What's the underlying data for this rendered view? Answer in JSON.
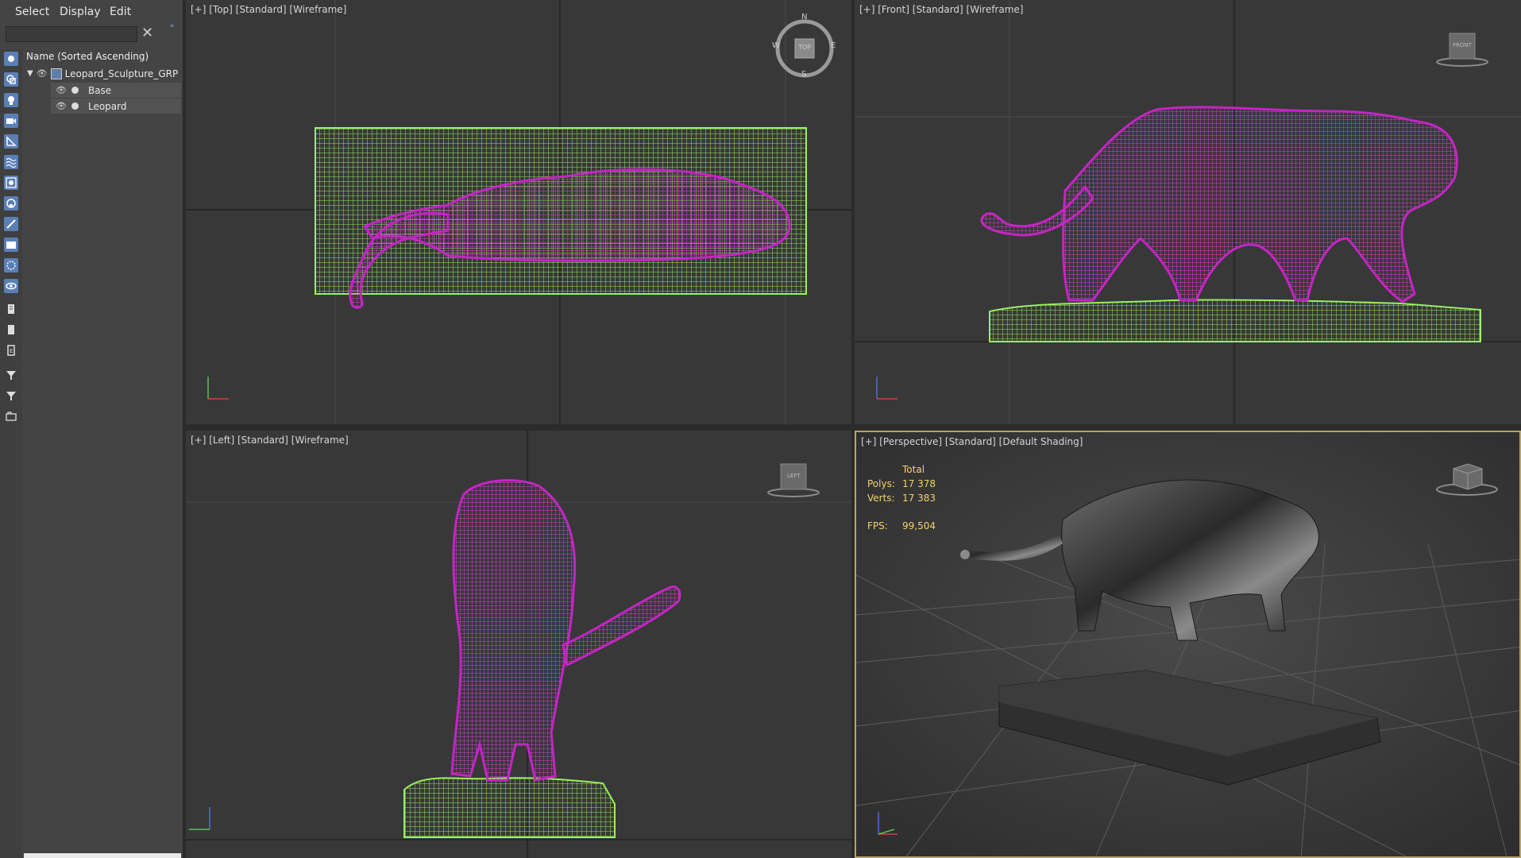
{
  "menu": {
    "select": "Select",
    "display": "Display",
    "edit": "Edit"
  },
  "search": {
    "value": "",
    "placeholder": ""
  },
  "explorer": {
    "column_header": "Name (Sorted Ascending)",
    "rows": [
      {
        "label": "Leopard_Sculpture_GRP"
      },
      {
        "label": "Base"
      },
      {
        "label": "Leopard"
      }
    ]
  },
  "viewports": {
    "top": {
      "label": "[+] [Top] [Standard] [Wireframe]",
      "cube_label": "TOP",
      "compass": {
        "n": "N",
        "s": "S",
        "e": "E",
        "w": "W"
      }
    },
    "front": {
      "label": "[+] [Front] [Standard] [Wireframe]",
      "cube_label": "FRONT"
    },
    "left": {
      "label": "[+] [Left] [Standard] [Wireframe]",
      "cube_label": "LEFT"
    },
    "persp": {
      "label": "[+] [Perspective] [Standard] [Default Shading]"
    }
  },
  "stats": {
    "total_label": "Total",
    "polys_label": "Polys:",
    "polys_value": "17 378",
    "verts_label": "Verts:",
    "verts_value": "17 383",
    "fps_label": "FPS:",
    "fps_value": "99,504"
  },
  "colors": {
    "wire_base": "#7ee04a",
    "wire_leopard": "#c425c4",
    "viewport_bg": "#383838",
    "active_border": "#b5a36a",
    "stats_text": "#f2d36b"
  }
}
